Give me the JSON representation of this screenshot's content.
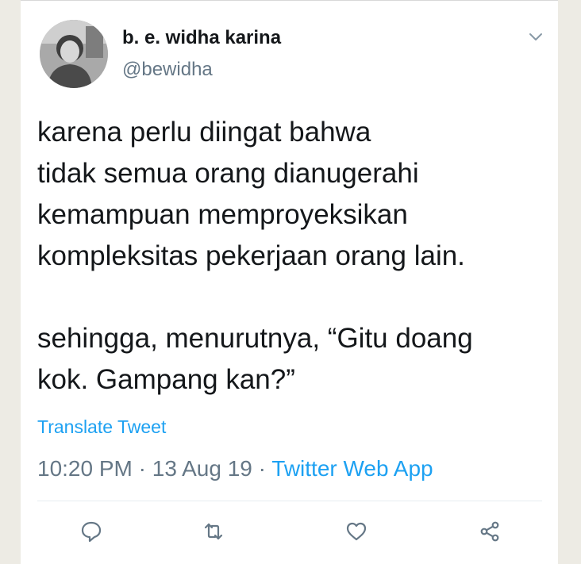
{
  "tweet": {
    "author_name": "b. e. widha karina",
    "author_handle": "@bewidha",
    "text": "karena perlu diingat bahwa\ntidak semua orang dianugerahi\nkemampuan memproyeksikan\nkompleksitas pekerjaan orang lain.\n\nsehingga, menurutnya, “Gitu doang\nkok. Gampang kan?”",
    "translate_label": "Translate Tweet",
    "time": "10:20 PM",
    "separator": " · ",
    "date": "13 Aug 19",
    "source": "Twitter Web App"
  },
  "actions": {
    "reply_icon": "reply-icon",
    "retweet_icon": "retweet-icon",
    "like_icon": "heart-icon",
    "share_icon": "share-icon"
  },
  "colors": {
    "link": "#1da1f2",
    "secondary_text": "#657786",
    "primary_text": "#14171a",
    "page_background": "#edebe4"
  }
}
